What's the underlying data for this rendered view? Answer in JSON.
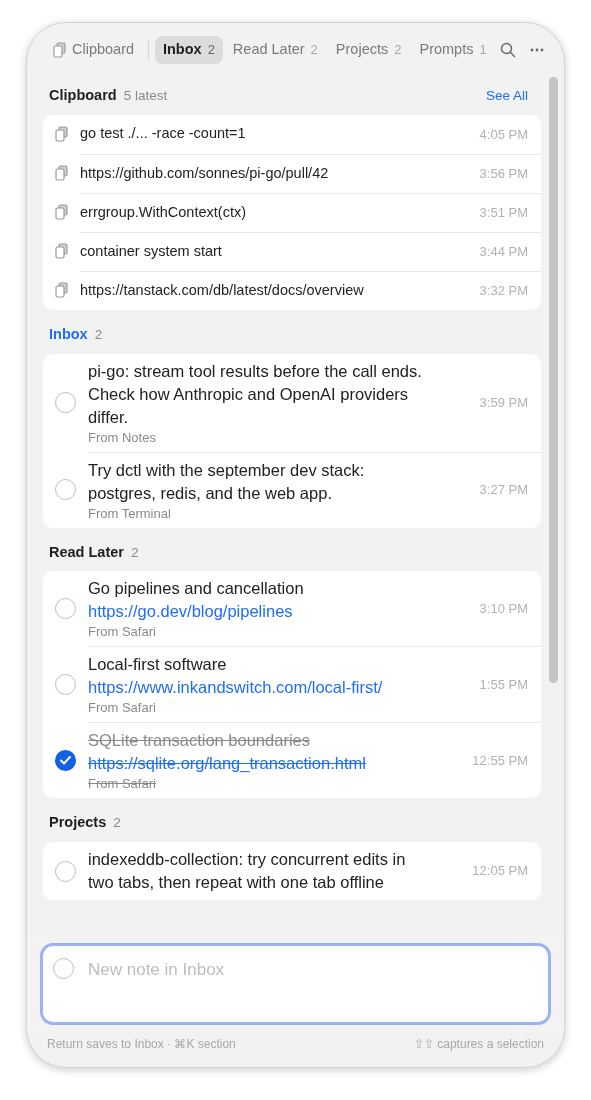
{
  "tabs": [
    {
      "kind": "clipboard",
      "label": "Clipboard",
      "selected": false
    },
    {
      "kind": "section",
      "label": "Inbox",
      "count": "2",
      "selected": true
    },
    {
      "kind": "section",
      "label": "Read Later",
      "count": "2",
      "selected": false
    },
    {
      "kind": "section",
      "label": "Projects",
      "count": "2",
      "selected": false
    },
    {
      "kind": "section",
      "label": "Prompts",
      "count": "1",
      "selected": false
    }
  ],
  "clipboard": {
    "title": "Clipboard",
    "subtitle": "5 latest",
    "action": "See All",
    "items": [
      {
        "text": "go test ./... -race -count=1",
        "time": "4:05 PM"
      },
      {
        "text": "https://github.com/sonnes/pi-go/pull/42",
        "time": "3:56 PM"
      },
      {
        "text": "errgroup.WithContext(ctx)",
        "time": "3:51 PM"
      },
      {
        "text": "container system start",
        "time": "3:44 PM"
      },
      {
        "text": "https://tanstack.com/db/latest/docs/overview",
        "time": "3:32 PM"
      }
    ]
  },
  "sections": [
    {
      "title": "Inbox",
      "count": "2",
      "selected": true,
      "items": [
        {
          "title": "pi-go: stream tool results before the call ends. Check how Anthropic and OpenAI providers differ.",
          "source": "From Notes",
          "time": "3:59 PM",
          "checked": false
        },
        {
          "title": "Try dctl with the september dev stack: postgres, redis, and the web app.",
          "source": "From Terminal",
          "time": "3:27 PM",
          "checked": false
        }
      ]
    },
    {
      "title": "Read Later",
      "count": "2",
      "selected": false,
      "items": [
        {
          "title": "Go pipelines and cancellation",
          "link": "https://go.dev/blog/pipelines",
          "source": "From Safari",
          "time": "3:10 PM",
          "checked": false
        },
        {
          "title": "Local-first software",
          "link": "https://www.inkandswitch.com/local-first/",
          "source": "From Safari",
          "time": "1:55 PM",
          "checked": false
        },
        {
          "title": "SQLite transaction boundaries",
          "link": "https://sqlite.org/lang_transaction.html",
          "source": "From Safari",
          "time": "12:55 PM",
          "checked": true
        }
      ]
    },
    {
      "title": "Projects",
      "count": "2",
      "selected": false,
      "items": [
        {
          "title": "indexeddb-collection: try concurrent edits in two tabs, then repeat with one tab offline",
          "time": "12:05 PM",
          "checked": false
        }
      ]
    }
  ],
  "composer": {
    "placeholder": "New note in Inbox"
  },
  "footer": {
    "left": "Return saves to Inbox · ⌘K section",
    "right": "⇧⇧ captures a selection"
  }
}
